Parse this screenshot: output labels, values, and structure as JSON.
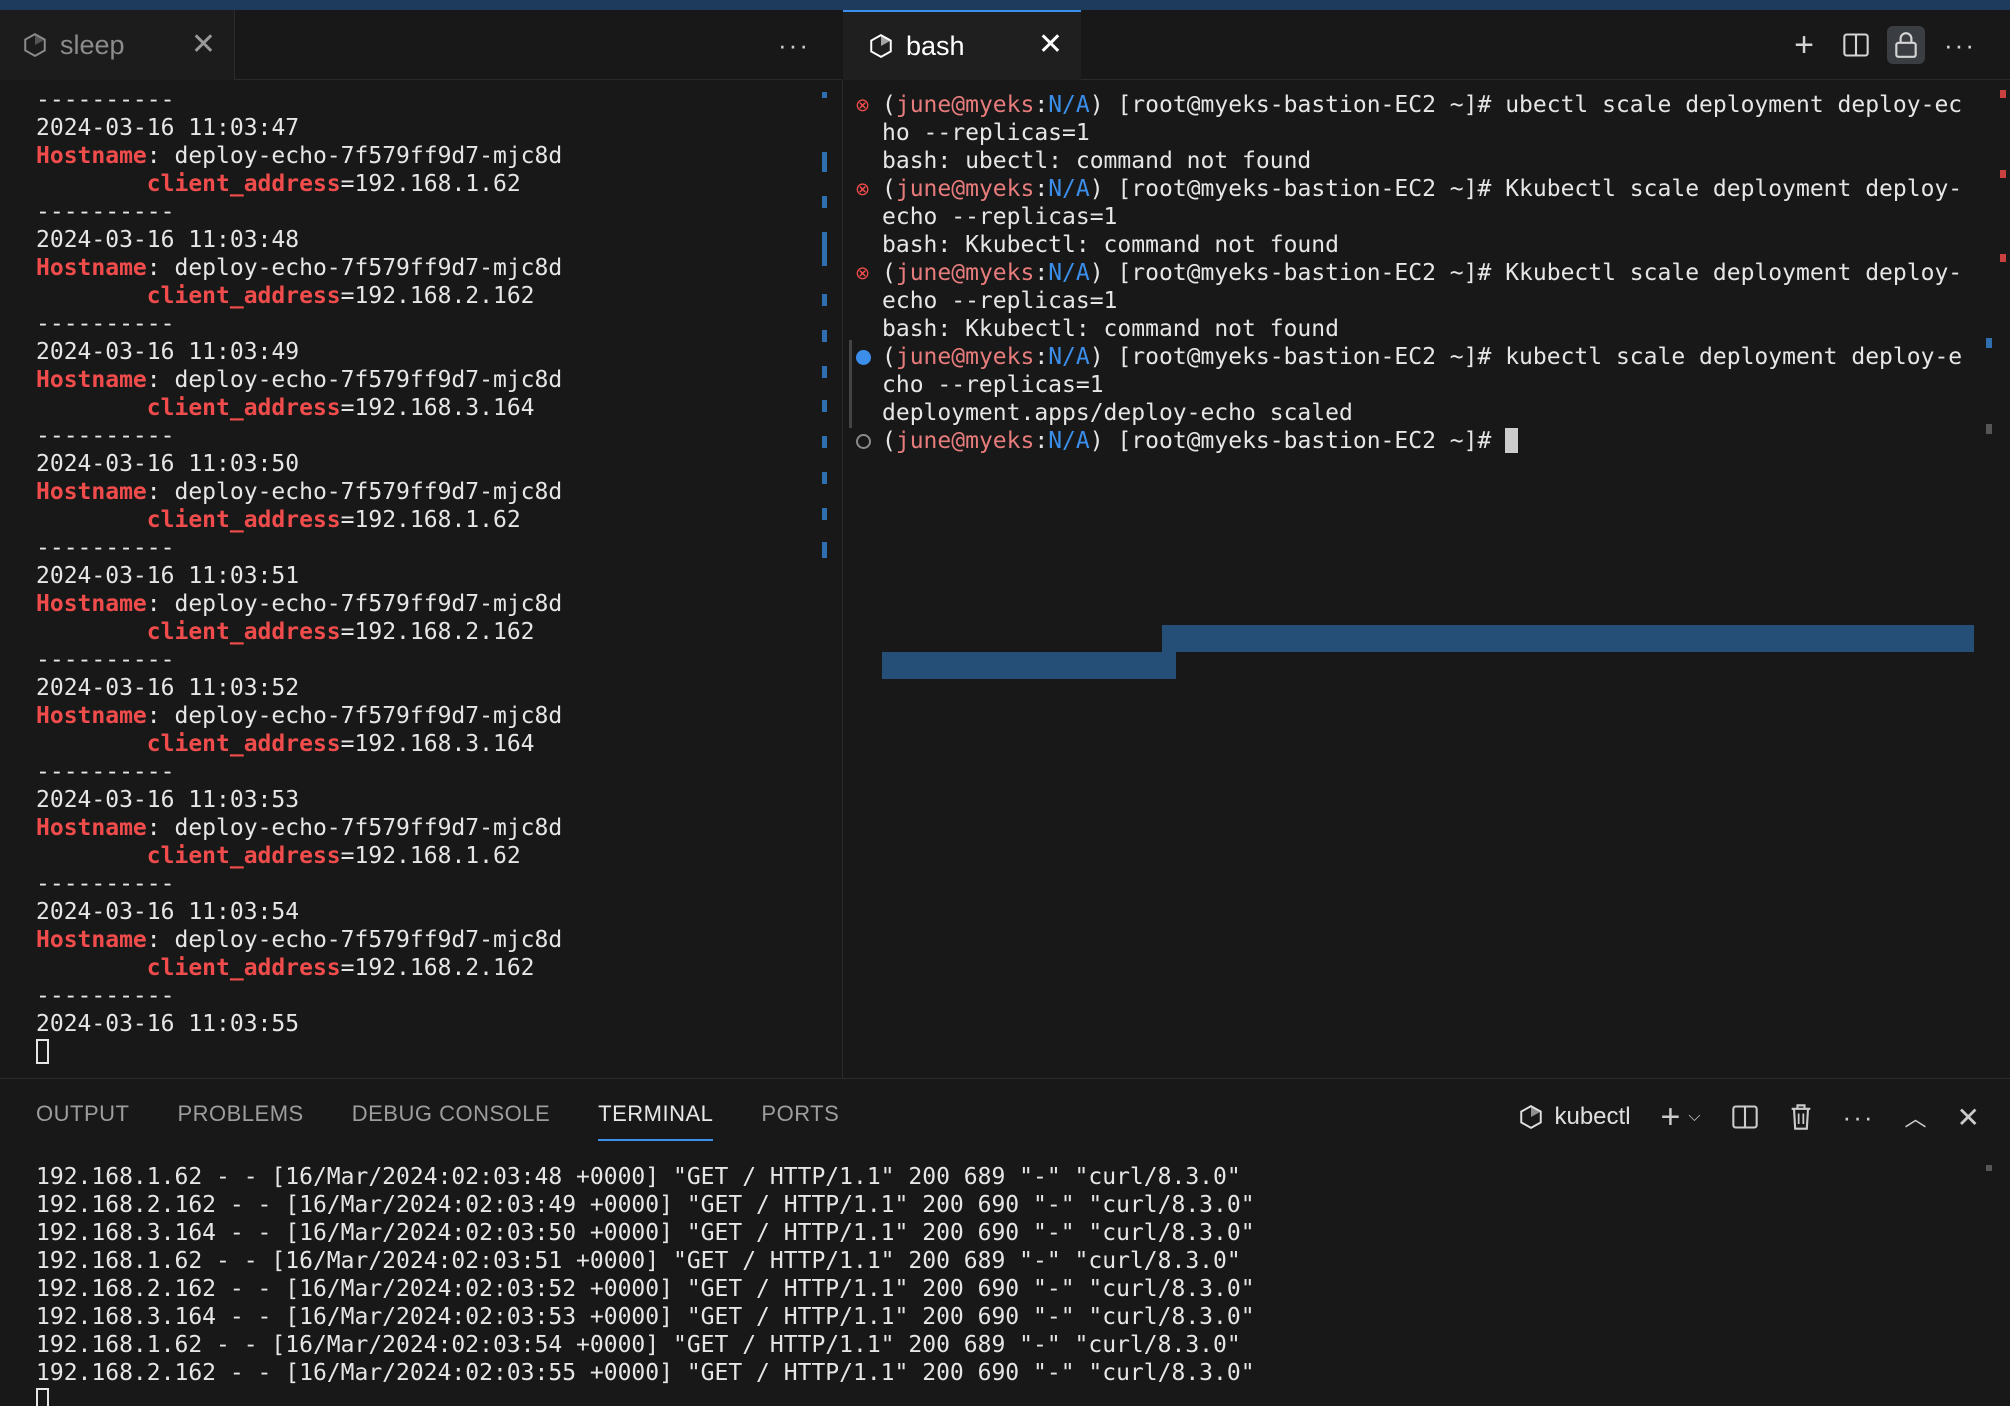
{
  "tabs": {
    "left": {
      "label": "sleep",
      "close": "✕",
      "more": "···"
    },
    "right": {
      "label": "bash",
      "close": "✕"
    },
    "actions": {
      "new": "+",
      "split": "split-editor-icon",
      "lock": "lock-icon",
      "more": "···"
    }
  },
  "left_terminal": {
    "separator": "----------",
    "hostname_label": "Hostname",
    "client_label": "client_address",
    "blocks": [
      {
        "time": "2024-03-16 11:03:47",
        "host": "deploy-echo-7f579ff9d7-mjc8d",
        "client": "192.168.1.62"
      },
      {
        "time": "2024-03-16 11:03:48",
        "host": "deploy-echo-7f579ff9d7-mjc8d",
        "client": "192.168.2.162"
      },
      {
        "time": "2024-03-16 11:03:49",
        "host": "deploy-echo-7f579ff9d7-mjc8d",
        "client": "192.168.3.164"
      },
      {
        "time": "2024-03-16 11:03:50",
        "host": "deploy-echo-7f579ff9d7-mjc8d",
        "client": "192.168.1.62"
      },
      {
        "time": "2024-03-16 11:03:51",
        "host": "deploy-echo-7f579ff9d7-mjc8d",
        "client": "192.168.2.162"
      },
      {
        "time": "2024-03-16 11:03:52",
        "host": "deploy-echo-7f579ff9d7-mjc8d",
        "client": "192.168.3.164"
      },
      {
        "time": "2024-03-16 11:03:53",
        "host": "deploy-echo-7f579ff9d7-mjc8d",
        "client": "192.168.1.62"
      },
      {
        "time": "2024-03-16 11:03:54",
        "host": "deploy-echo-7f579ff9d7-mjc8d",
        "client": "192.168.2.162"
      }
    ],
    "last_time": "2024-03-16 11:03:55"
  },
  "right_terminal": {
    "prompt_user": "june@myeks",
    "prompt_ctx": "N/A",
    "prompt_host": " [root@myeks-bastion-EC2 ~]# ",
    "commands": [
      {
        "status": "error",
        "line1": "ubectl scale deployment deploy-ec",
        "line2": "ho --replicas=1",
        "output": "bash: ubectl: command not found"
      },
      {
        "status": "error",
        "line1": "Kkubectl scale deployment deploy-",
        "line2": "echo --replicas=1",
        "output": "bash: Kkubectl: command not found"
      },
      {
        "status": "error",
        "line1": "Kkubectl scale deployment deploy-",
        "line2": "echo --replicas=1",
        "output": "bash: Kkubectl: command not found"
      },
      {
        "status": "success",
        "line1": "kubectl scale deployment deploy-e",
        "line2": "cho --replicas=1",
        "output": "deployment.apps/deploy-echo scaled"
      }
    ]
  },
  "panel": {
    "tabs": [
      "OUTPUT",
      "PROBLEMS",
      "DEBUG CONSOLE",
      "TERMINAL",
      "PORTS"
    ],
    "active_tab": "TERMINAL",
    "terminal_name": "kubectl",
    "log_lines": [
      "192.168.1.62 - - [16/Mar/2024:02:03:48 +0000] \"GET / HTTP/1.1\" 200 689 \"-\" \"curl/8.3.0\"",
      "192.168.2.162 - - [16/Mar/2024:02:03:49 +0000] \"GET / HTTP/1.1\" 200 690 \"-\" \"curl/8.3.0\"",
      "192.168.3.164 - - [16/Mar/2024:02:03:50 +0000] \"GET / HTTP/1.1\" 200 690 \"-\" \"curl/8.3.0\"",
      "192.168.1.62 - - [16/Mar/2024:02:03:51 +0000] \"GET / HTTP/1.1\" 200 689 \"-\" \"curl/8.3.0\"",
      "192.168.2.162 - - [16/Mar/2024:02:03:52 +0000] \"GET / HTTP/1.1\" 200 690 \"-\" \"curl/8.3.0\"",
      "192.168.3.164 - - [16/Mar/2024:02:03:53 +0000] \"GET / HTTP/1.1\" 200 690 \"-\" \"curl/8.3.0\"",
      "192.168.1.62 - - [16/Mar/2024:02:03:54 +0000] \"GET / HTTP/1.1\" 200 689 \"-\" \"curl/8.3.0\"",
      "192.168.2.162 - - [16/Mar/2024:02:03:55 +0000] \"GET / HTTP/1.1\" 200 690 \"-\" \"curl/8.3.0\""
    ]
  },
  "colors": {
    "accent": "#3b8eea",
    "error": "#f14c4c",
    "prompt_user": "#e87c7c",
    "selection": "#264f78"
  }
}
